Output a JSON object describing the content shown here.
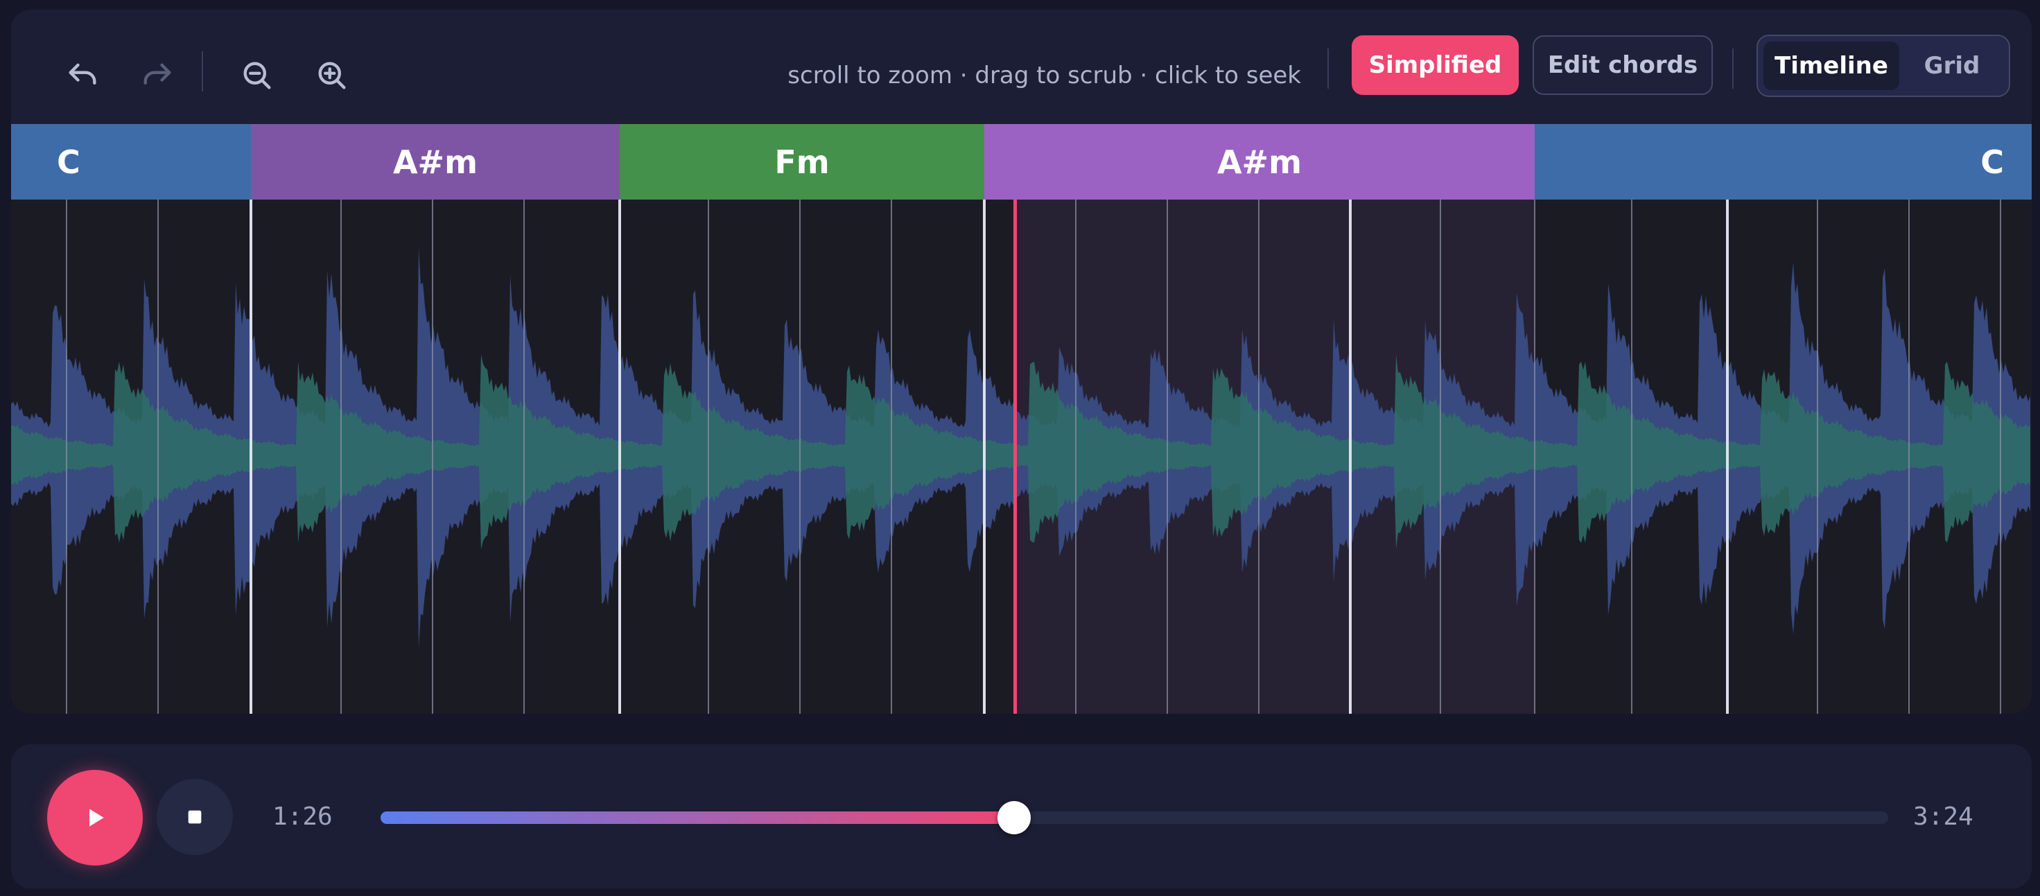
{
  "toolbar": {
    "icons": [
      "undo-icon",
      "redo-icon",
      "zoom-out-icon",
      "zoom-in-icon"
    ],
    "hint": "scroll to zoom · drag to scrub · click to seek",
    "simplified_label": "Simplified",
    "edit_chords_label": "Edit chords",
    "view_modes": [
      "Timeline",
      "Grid"
    ],
    "active_view": "Timeline"
  },
  "chords": [
    {
      "name": "C",
      "color": "#3e6ca8",
      "align": "left"
    },
    {
      "name": "A#m",
      "color": "#7e55a5"
    },
    {
      "name": "Fm",
      "color": "#43914a"
    },
    {
      "name": "A#m",
      "color": "#9b62c4"
    },
    {
      "name": "C",
      "color": "#3e6ca8",
      "align": "right"
    }
  ],
  "colors": {
    "accent": "#ef4672",
    "playhead": "#ef4672",
    "wave_low": "#2f6f69",
    "wave_high": "#3a4d86",
    "background": "#151729"
  },
  "transport": {
    "current_time": "1:26",
    "total_time": "3:24",
    "progress": 0.42,
    "play_icon": "play-icon",
    "stop_icon": "stop-icon"
  }
}
